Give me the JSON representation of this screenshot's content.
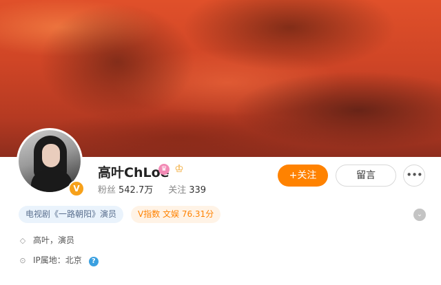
{
  "profile": {
    "name": "高叶ChLoe",
    "verified_badge": "V",
    "name_badge": "svip-badge-icon",
    "crown": "crown-icon",
    "followers_label": "粉丝",
    "followers_value": "542.7万",
    "following_label": "关注",
    "following_value": "339"
  },
  "actions": {
    "follow_label": "+关注",
    "message_label": "留言",
    "more_label": "•••"
  },
  "tags": {
    "role": "电视剧《一路朝阳》演员",
    "v_index": "V指数 文娱 76.31分"
  },
  "info": {
    "bio": "高叶，演员",
    "ip": "IP属地：北京"
  },
  "colors": {
    "accent": "#ff8200",
    "cover": "#cf4526"
  }
}
